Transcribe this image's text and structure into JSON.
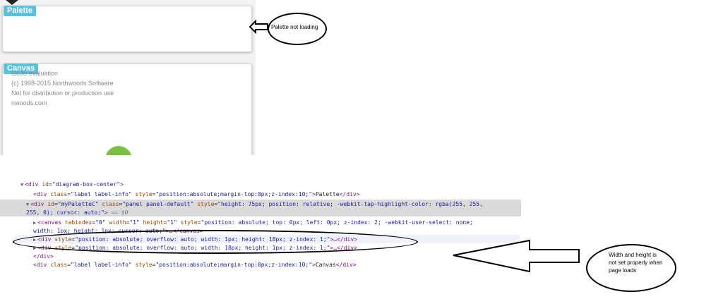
{
  "palette_panel": {
    "label": "Palette"
  },
  "canvas_panel": {
    "label": "Canvas",
    "watermark": [
      "GoJS evaluation",
      "(c) 1998-2015 Northwoods Software",
      "Not for distribution or production use",
      "nwoods.com"
    ]
  },
  "callouts": {
    "palette": "Palette not loading",
    "size": "Width and height is not set properly when page loads"
  },
  "colors": {
    "label_info": "#5bc0de",
    "node": "#7ac143",
    "tag": "#881280",
    "attr_name": "#994500",
    "attr_value": "#1a1aa6"
  },
  "devtools": {
    "l1": {
      "open": "<div ",
      "a1n": "id",
      "a1v": "\"diagram-box-center\"",
      "close": ">"
    },
    "l2": {
      "open": "<div ",
      "a1n": "class",
      "a1v": "\"label label-info\"",
      "a2n": "style",
      "a2v": "\"position:absolute;margin-top:0px;z-index:10;\"",
      "close": ">",
      "text": "Palette",
      "end": "</div>"
    },
    "l3": {
      "open": "<div ",
      "a1n": "id",
      "a1v": "\"myPaletteC\"",
      "a2n": "class",
      "a2v": "\"panel panel-default\"",
      "a3n": "style",
      "a3v": "\"height: 75px; position: relative; -webkit-tap-highlight-color: rgba(255, 255,",
      "": ""
    },
    "l3b": {
      "text": "255, 0); cursor: auto;\"",
      "close": ">",
      "eq": " == $0"
    },
    "l4": {
      "open": "<canvas ",
      "a1n": "tabindex",
      "a1v": "\"0\"",
      "a2n": "width",
      "a2v": "\"1\"",
      "a3n": "height",
      "a3v": "\"1\"",
      "a4n": "style",
      "a4v": "\"position: absolute; top: 0px; left: 0px; z-index: 2; -webkit-user-select: none;"
    },
    "l4b": {
      "text": "width: 1px; height: 1px; cursor: auto;\"",
      "close": ">…</canvas>"
    },
    "l5": {
      "open": "<div ",
      "a1n": "style",
      "a1v": "\"position: absolute; overflow: auto; width: 1px; height: 18px; z-index: 1;\"",
      "close": ">…</div>"
    },
    "l6": {
      "open": "<div ",
      "a1n": "style",
      "a1v": "\"position: absolute; overflow: auto; width: 18px; height: 1px; z-index: 1;\"",
      "close": ">…</div>"
    },
    "l7": {
      "end": "</div>"
    },
    "l8": {
      "open": "<div ",
      "a1n": "class",
      "a1v": "\"label label-info\"",
      "a2n": "style",
      "a2v": "\"position:absolute;margin-top:0px;z-index:10;\"",
      "close": ">",
      "text": "Canvas",
      "end": "</div>"
    }
  }
}
